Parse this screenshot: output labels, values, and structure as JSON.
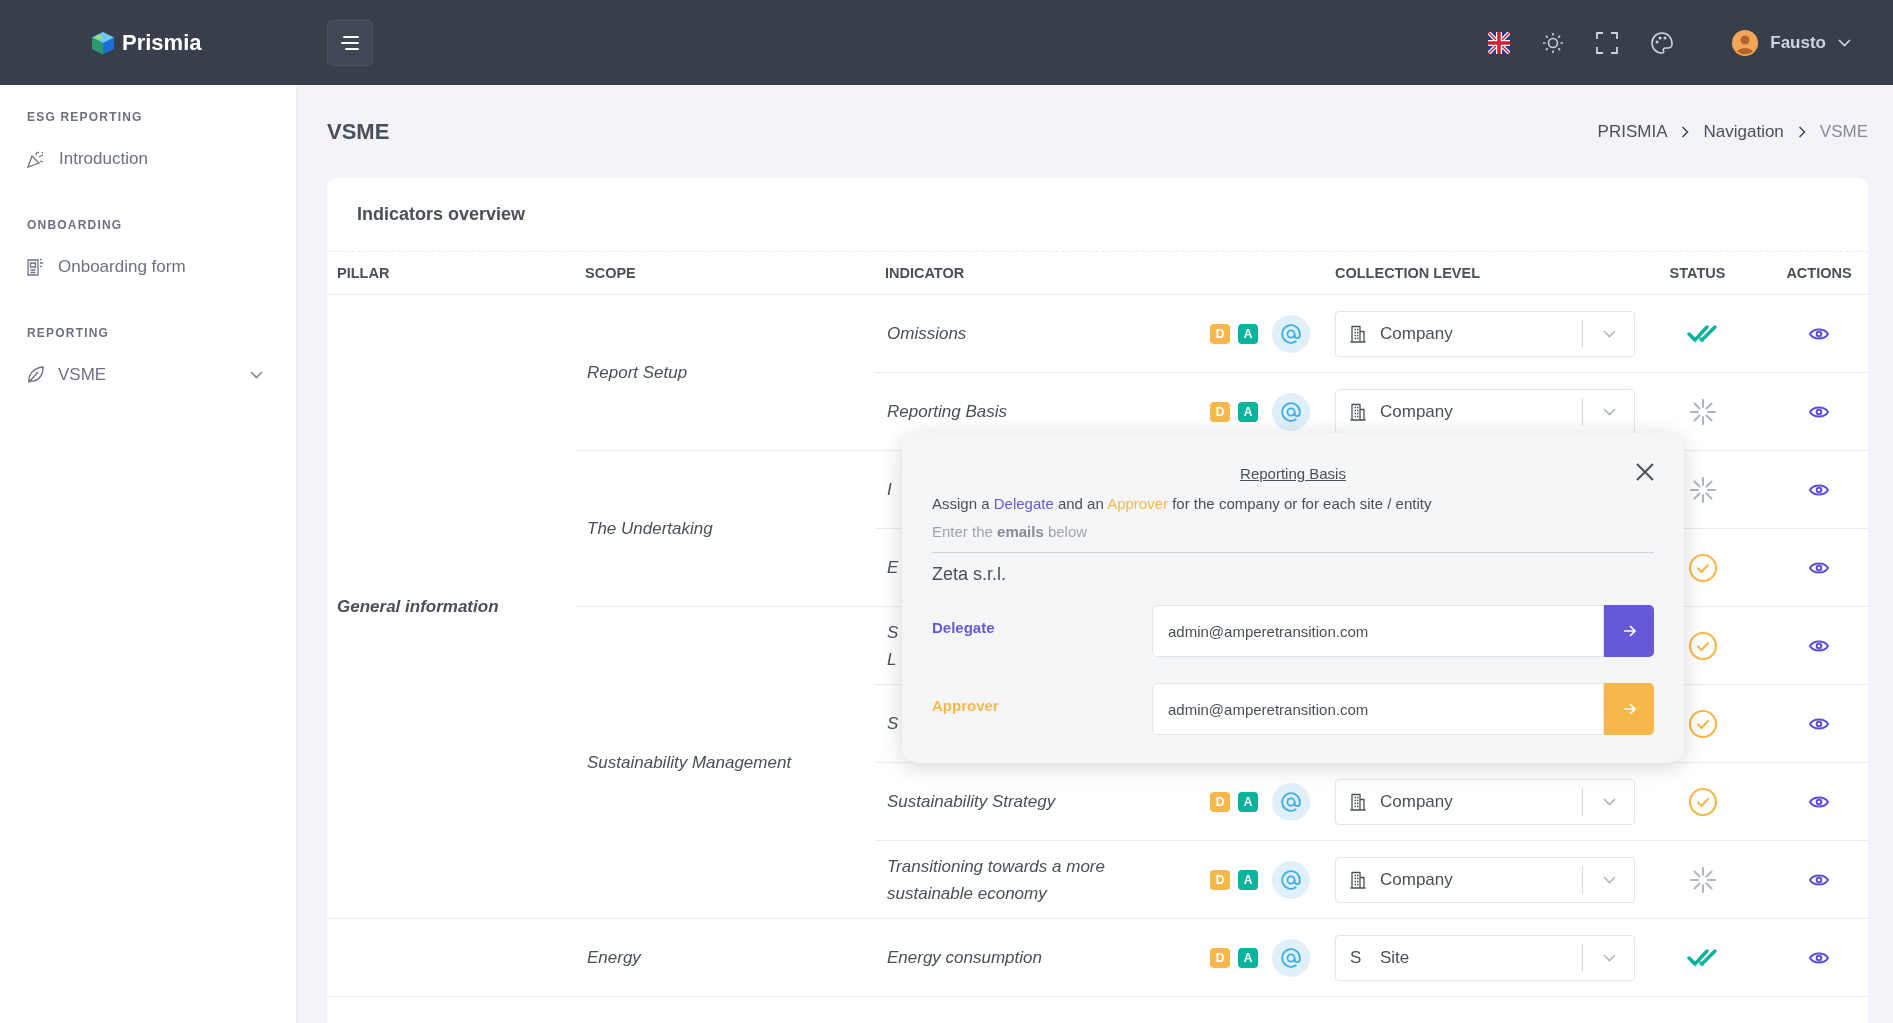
{
  "header": {
    "brand": "Prismia",
    "user": "Fausto"
  },
  "sidebar": {
    "sections": [
      {
        "title": "ESG REPORTING",
        "items": [
          {
            "label": "Introduction",
            "has_children": false
          }
        ]
      },
      {
        "title": "ONBOARDING",
        "items": [
          {
            "label": "Onboarding form",
            "has_children": false
          }
        ]
      },
      {
        "title": "REPORTING",
        "items": [
          {
            "label": "VSME",
            "has_children": true
          }
        ]
      }
    ]
  },
  "page": {
    "title": "VSME",
    "breadcrumb": [
      {
        "label": "PRISMIA",
        "current": false
      },
      {
        "label": "Navigation",
        "current": false
      },
      {
        "label": "VSME",
        "current": true
      }
    ]
  },
  "card": {
    "title": "Indicators overview",
    "columns": [
      "PILLAR",
      "SCOPE",
      "INDICATOR",
      "COLLECTION LEVEL",
      "STATUS",
      "ACTIONS"
    ],
    "pillars": [
      {
        "name": "General information",
        "scopes": [
          {
            "name": "Report Setup",
            "indicators": [
              {
                "name": "Omissions",
                "badges": [
                  {
                    "text": "D",
                    "color": "#f7b84b"
                  },
                  {
                    "text": "A",
                    "color": "#0ab39c"
                  }
                ],
                "collection": {
                  "label": "Company"
                },
                "kind": "approved"
              },
              {
                "name": "Reporting Basis",
                "badges": [
                  {
                    "text": "D",
                    "color": "#f7b84b"
                  },
                  {
                    "text": "A",
                    "color": "#0ab39c"
                  }
                ],
                "collection": {
                  "label": "Company"
                },
                "kind": "pending"
              }
            ]
          },
          {
            "name": "The Undertaking",
            "indicators": [
              {
                "name": "I",
                "kind": "pending"
              },
              {
                "name": "E",
                "kind": "submitted"
              }
            ]
          },
          {
            "name": "Sustainability Management",
            "indicators": [
              {
                "name": "S\nL",
                "kind": "submitted"
              },
              {
                "name": "S",
                "kind": "submitted"
              },
              {
                "name": "Sustainability Strategy",
                "badges": [
                  {
                    "text": "D",
                    "color": "#f7b84b"
                  },
                  {
                    "text": "A",
                    "color": "#0ab39c"
                  }
                ],
                "collection": {
                  "label": "Company"
                },
                "kind": "submitted"
              },
              {
                "name": "Transitioning towards a more sustainable economy",
                "badges": [
                  {
                    "text": "D",
                    "color": "#f7b84b"
                  },
                  {
                    "text": "A",
                    "color": "#0ab39c"
                  }
                ],
                "collection": {
                  "label": "Company"
                },
                "kind": "pending"
              }
            ]
          }
        ]
      },
      {
        "scopes": [
          {
            "name": "Energy",
            "indicators": [
              {
                "name": "Energy consumption",
                "badges": [
                  {
                    "text": "D",
                    "color": "#f7b84b"
                  },
                  {
                    "text": "A",
                    "color": "#0ab39c"
                  }
                ],
                "collection": {
                  "label": "Site",
                  "letter": "S"
                },
                "kind": "approved"
              }
            ]
          }
        ]
      }
    ]
  },
  "modal": {
    "title": "Reporting Basis",
    "intro": [
      {
        "text": "Assign a ",
        "kind": "plain"
      },
      {
        "text": "Delegate",
        "kind": "delegate"
      },
      {
        "text": " and an ",
        "kind": "plain"
      },
      {
        "text": "Approver",
        "kind": "approver"
      },
      {
        "text": " for the company or for each site / entity",
        "kind": "plain"
      }
    ],
    "hint": "Enter the **emails** below",
    "entity": "Zeta s.r.l.",
    "assignees": [
      {
        "kind": "delegate",
        "label": "Delegate",
        "value": "admin@amperetransition.com"
      },
      {
        "kind": "approver",
        "label": "Approver",
        "value": "admin@amperetransition.com"
      }
    ]
  }
}
